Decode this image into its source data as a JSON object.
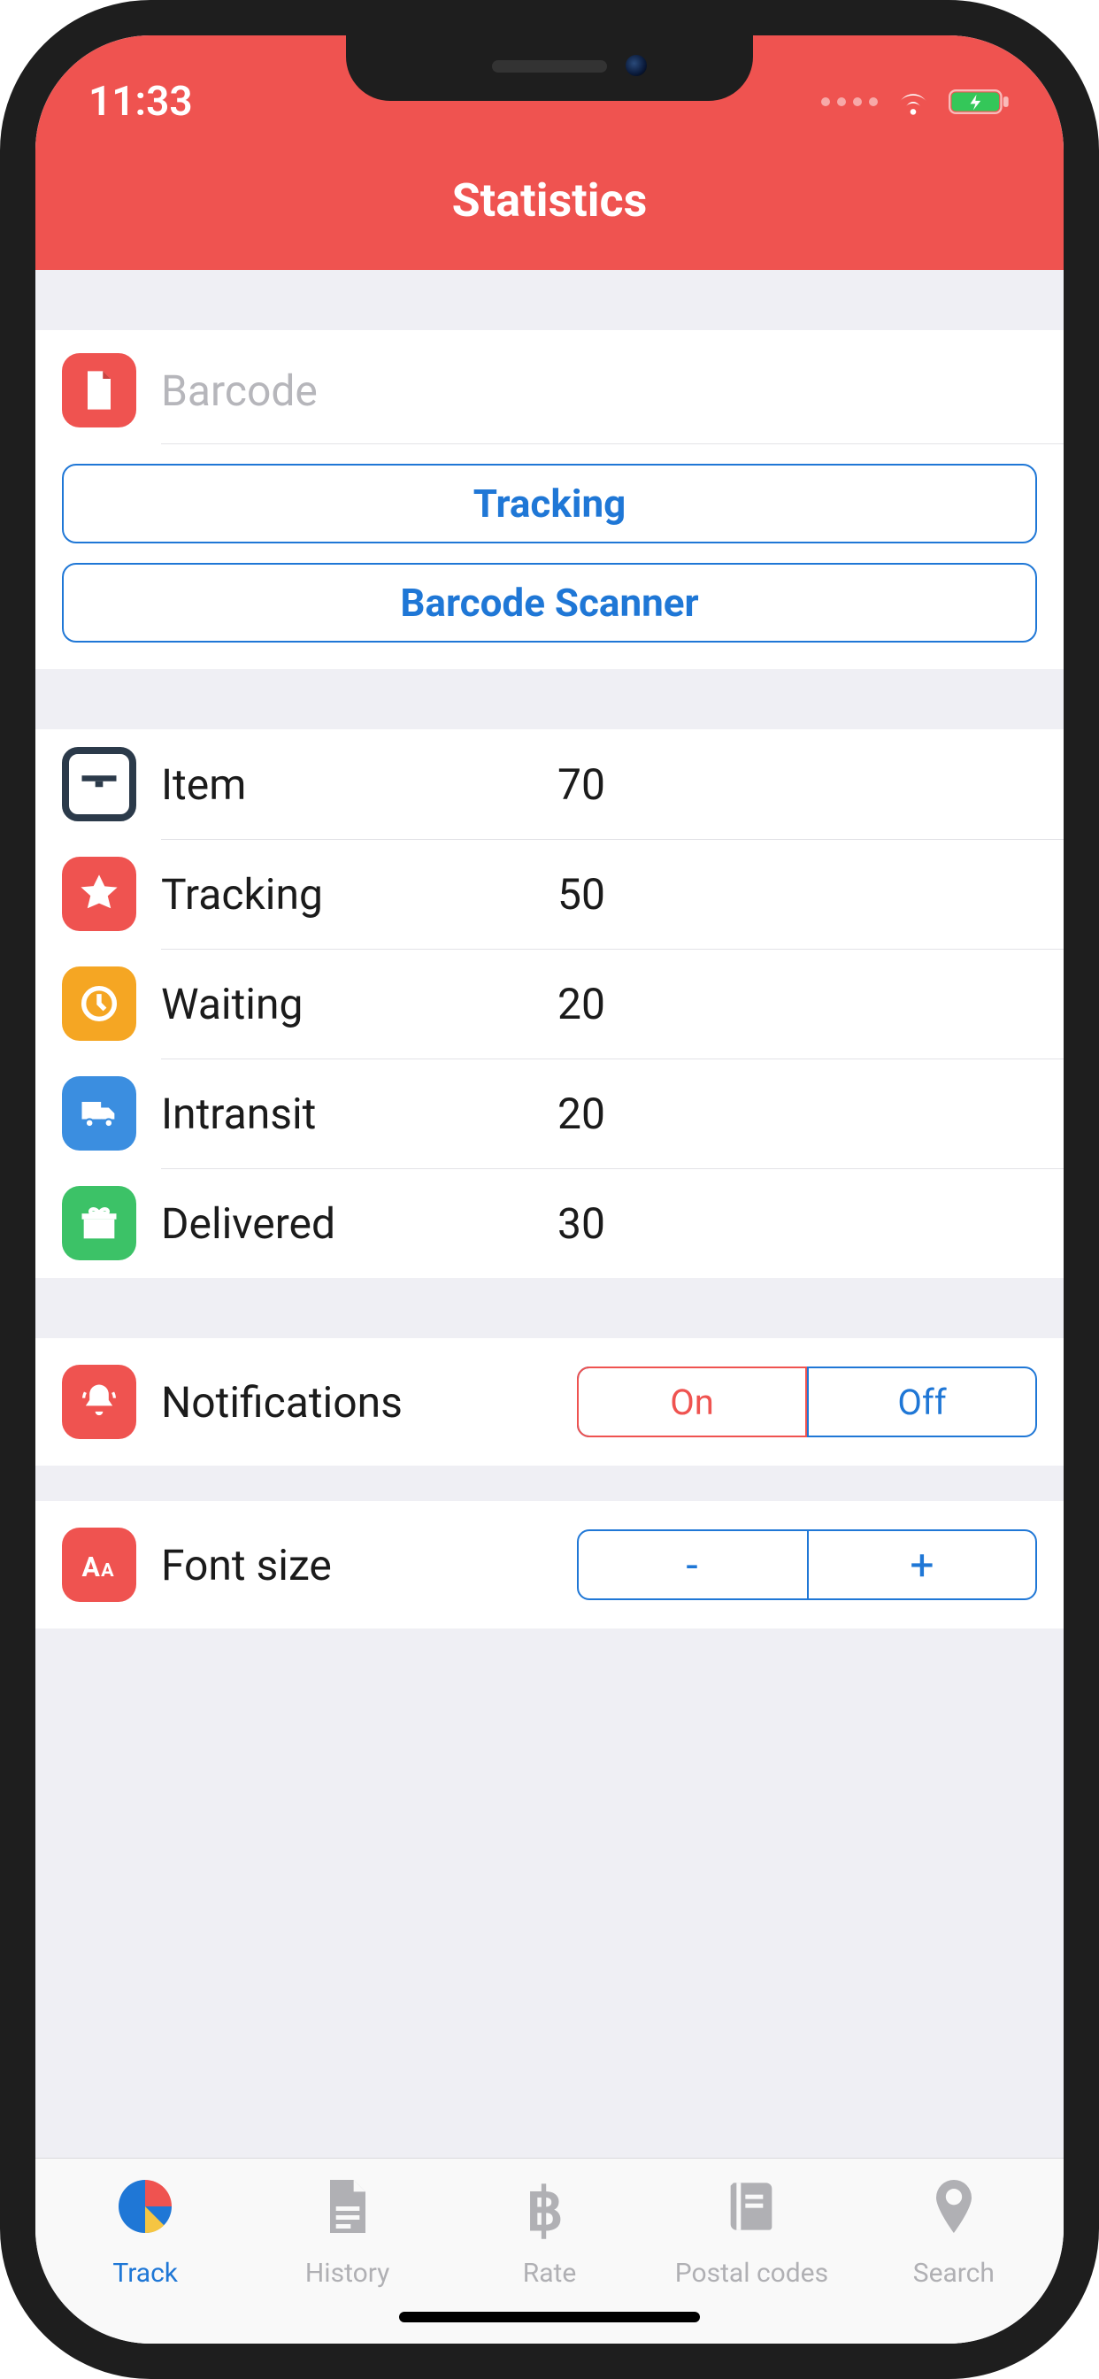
{
  "status": {
    "time": "11:33"
  },
  "header": {
    "title": "Statistics"
  },
  "barcode": {
    "placeholder": "Barcode",
    "tracking_label": "Tracking",
    "scanner_label": "Barcode Scanner"
  },
  "stats": {
    "item": {
      "label": "Item",
      "value": "70"
    },
    "tracking": {
      "label": "Tracking",
      "value": "50"
    },
    "waiting": {
      "label": "Waiting",
      "value": "20"
    },
    "intransit": {
      "label": "Intransit",
      "value": "20"
    },
    "delivered": {
      "label": "Delivered",
      "value": "30"
    }
  },
  "settings": {
    "notifications": {
      "label": "Notifications",
      "on": "On",
      "off": "Off"
    },
    "fontsize": {
      "label": "Font size",
      "minus": "-",
      "plus": "+"
    }
  },
  "tabs": {
    "track": "Track",
    "history": "History",
    "rate": "Rate",
    "postal": "Postal codes",
    "search": "Search"
  }
}
